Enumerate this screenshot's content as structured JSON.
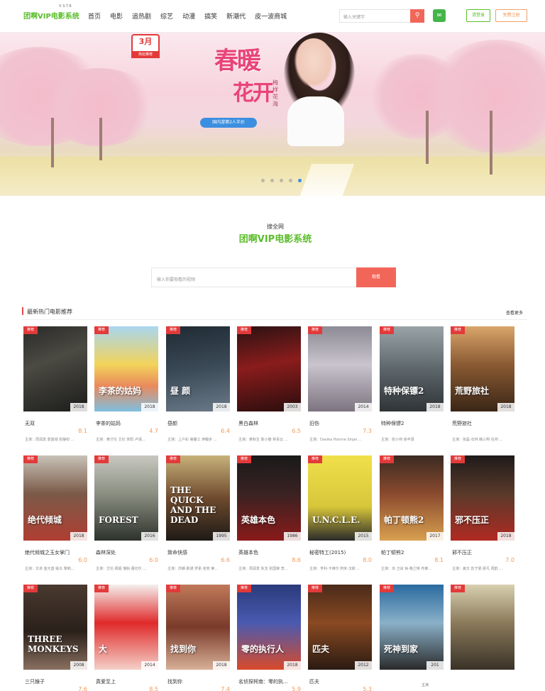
{
  "header": {
    "logo": "团啊VIP电影系统",
    "version": "V 3.7.6",
    "nav": [
      "首页",
      "电影",
      "追热剧",
      "综艺",
      "动漫",
      "搞笑",
      "新潮代",
      "皮一波商城"
    ],
    "search_placeholder": "输入关键字",
    "login": "请登录",
    "register": "免费注册"
  },
  "banner": {
    "badge_month": "3月",
    "badge_tag": "热玩推荐",
    "title_1": "春暖",
    "title_2": "花开",
    "subtitle": "梅样花海",
    "ribbon": "国内游第2人半价"
  },
  "site": {
    "sub": "搜全网",
    "name": "团啊VIP电影系统",
    "search_placeholder": "输入你要观看的视频",
    "search_button": "观看"
  },
  "section": {
    "title": "最新热门电影推荐",
    "more": "查看更多",
    "tag": "推荐"
  },
  "movies": [
    {
      "name": "无双",
      "score": "8.1",
      "year": "2018",
      "cast": "主演：周润发 郭富城 张静初 ...",
      "poster_text": ""
    },
    {
      "name": "李茶的姑妈",
      "score": "4.7",
      "year": "2018",
      "cast": "主演：黄才伦 艾伦 宋阳 卢靖...",
      "poster_text": "李茶的姑妈"
    },
    {
      "name": "昼颜",
      "score": "6.4",
      "year": "2018",
      "cast": "主演：上户彩 斋藤工 伊藤步 ...",
      "poster_text": "昼 颜"
    },
    {
      "name": "黑白森林",
      "score": "6.5",
      "year": "2003",
      "cast": "主演：黄秋生 陈小春 林青云 ...",
      "poster_text": ""
    },
    {
      "name": "旧伤",
      "score": "7.3",
      "year": "2014",
      "cast": "主演：Davika Hoorne Sinjai ...",
      "poster_text": ""
    },
    {
      "name": "特种保镖2",
      "score": "",
      "year": "2018",
      "cast": "主演：张小帅 徐丰源",
      "poster_text": "特种保镖2"
    },
    {
      "name": "荒野旅社",
      "score": "",
      "year": "2018",
      "cast": "主演：张磊 石林 韩三明 任帅 ...",
      "poster_text": "荒野旅社"
    },
    {
      "name": "绝代倾城之玉女掌门",
      "score": "6.0",
      "year": "2018",
      "cast": "主演：文卓 金元基 姚瓜 黎莉...",
      "poster_text": "绝代倾城"
    },
    {
      "name": "森林深处",
      "score": "6.0",
      "year": "2016",
      "cast": "主演：艾伦·佩姬 瑞秋·蕾切尔 ...",
      "poster_text": "FOREST"
    },
    {
      "name": "致命快感",
      "score": "6.6",
      "year": "1995",
      "cast": "主演：莎朗·斯通 罗素·克劳 莱...",
      "poster_text": "THE QUICK AND THE DEAD"
    },
    {
      "name": "英雄本色",
      "score": "8.6",
      "year": "1986",
      "cast": "主演：周润发 狄龙 张国荣 李...",
      "poster_text": "英雄本色"
    },
    {
      "name": "秘密特工(2015)",
      "score": "8.0",
      "year": "2015",
      "cast": "主演：亨利·卡维尔 阿米·汉默 ...",
      "poster_text": "U.N.C.L.E."
    },
    {
      "name": "帕丁顿熊2",
      "score": "8.1",
      "year": "2017",
      "cast": "主演：本·卫肖 休·格兰特 布莱...",
      "poster_text": "帕丁顿熊2"
    },
    {
      "name": "邪不压正",
      "score": "7.0",
      "year": "2018",
      "cast": "主演：姜文 彭于晏 廖凡 周韵 ...",
      "poster_text": "邪不压正"
    },
    {
      "name": "三只猴子",
      "score": "7.6",
      "year": "2008",
      "cast": "",
      "poster_text": "THREE MONKEYS"
    },
    {
      "name": "真爱至上",
      "score": "8.5",
      "year": "2014",
      "cast": "",
      "poster_text": "大"
    },
    {
      "name": "找到你",
      "score": "7.4",
      "year": "2018",
      "cast": "",
      "poster_text": "找到你"
    },
    {
      "name": "名侦探柯南：零的执...",
      "score": "5.9",
      "year": "2018",
      "cast": "",
      "poster_text": "零的执行人"
    },
    {
      "name": "匹夫",
      "score": "5.3",
      "year": "2012",
      "cast": "",
      "poster_text": "匹夫"
    },
    {
      "name": "",
      "score": "",
      "year": "201",
      "cast": "",
      "poster_text": "死神到家"
    },
    {
      "name": "",
      "score": "",
      "year": "",
      "cast": "",
      "poster_text": ""
    }
  ],
  "watermark": "主演"
}
